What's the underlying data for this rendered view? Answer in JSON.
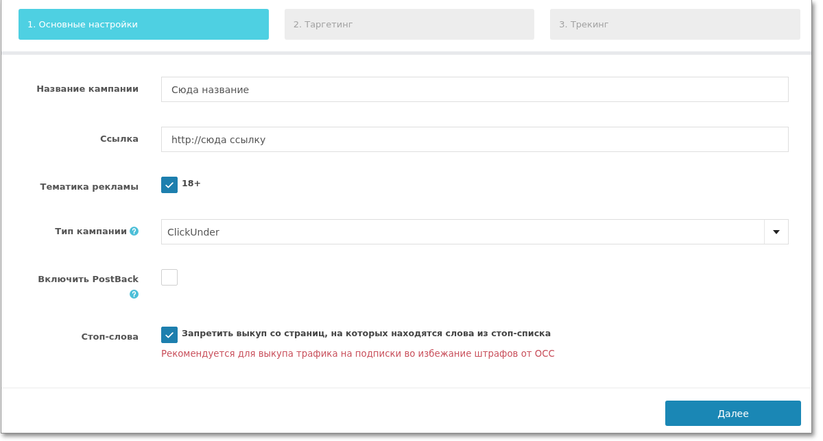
{
  "steps": [
    {
      "label": "1. Основные настройки",
      "selected": true
    },
    {
      "label": "2. Таргетинг",
      "selected": false
    },
    {
      "label": "3. Трекинг",
      "selected": false
    }
  ],
  "form": {
    "fields": [
      {
        "kind": "text",
        "label": "Название кампании",
        "help": false,
        "value": "Сюда название"
      },
      {
        "kind": "text",
        "label": "Ссылка",
        "help": false,
        "value": "http://сюда ссылку"
      },
      {
        "kind": "checkbox",
        "label": "Тематика рекламы",
        "help": false,
        "checked": true,
        "text": "18+"
      },
      {
        "kind": "select",
        "label": "Тип кампании",
        "help": true,
        "value": "ClickUnder"
      },
      {
        "kind": "checkbox",
        "label": "Включить PostBack",
        "help": true,
        "checked": false
      },
      {
        "kind": "checkbox",
        "label": "Стоп-слова",
        "help": false,
        "checked": true,
        "text": "Запретить выкуп со страниц, на которых находятся слова из стоп-списка",
        "note": "Рекомендуется для выкупа трафика на подписки во избежание штрафов от ОСС"
      }
    ]
  },
  "next_button": "Далее"
}
